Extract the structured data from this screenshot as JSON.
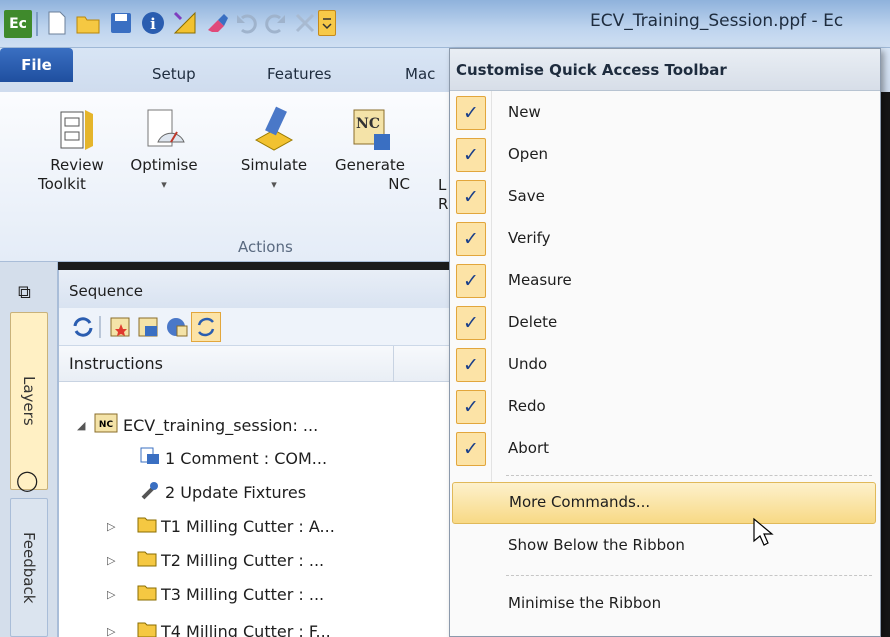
{
  "app": {
    "logo": "Ec",
    "document_title": "ECV_Training_Session.ppf - Ec"
  },
  "quick_access": {
    "icons": [
      "new-document-icon",
      "open-folder-icon",
      "save-icon",
      "info-icon",
      "measure-icon",
      "delete-icon",
      "undo-icon",
      "redo-icon",
      "abort-icon",
      "customise-dropdown-icon"
    ]
  },
  "ribbon": {
    "tabs": [
      "File",
      "Setup",
      "Features",
      "Mac"
    ],
    "buttons": [
      {
        "label_line1": "Review",
        "label_line2": "Toolkit"
      },
      {
        "label_line1": "Optimise",
        "label_line2": "▾"
      },
      {
        "label_line1": "Simulate",
        "label_line2": "▾"
      },
      {
        "label_line1": "Generate",
        "label_line2": "NC"
      },
      {
        "label_line1": "L",
        "label_line2": "R"
      }
    ],
    "group_label": "Actions"
  },
  "side_tabs": {
    "layers": "Layers",
    "feedback": "Feedback"
  },
  "sequence": {
    "title": "Sequence",
    "column_header": "Instructions",
    "rows": [
      {
        "expander": "◢",
        "text": "ECV_training_session: ..."
      },
      {
        "expander": "",
        "text": "1 Comment : COM..."
      },
      {
        "expander": "",
        "text": "2 Update Fixtures"
      },
      {
        "expander": "▷",
        "text": "T1 Milling Cutter : A..."
      },
      {
        "expander": "▷",
        "text": "T2 Milling Cutter : ..."
      },
      {
        "expander": "▷",
        "text": "T3 Milling Cutter : ..."
      },
      {
        "expander": "▷",
        "text": "T4 Milling Cutter : F..."
      }
    ]
  },
  "menu": {
    "title": "Customise Quick Access Toolbar",
    "items": [
      {
        "label": "New",
        "checked": "✓"
      },
      {
        "label": "Open",
        "checked": "✓"
      },
      {
        "label": "Save",
        "checked": "✓"
      },
      {
        "label": "Verify",
        "checked": "✓"
      },
      {
        "label": "Measure",
        "checked": "✓"
      },
      {
        "label": "Delete",
        "checked": "✓"
      },
      {
        "label": "Undo",
        "checked": "✓"
      },
      {
        "label": "Redo",
        "checked": "✓"
      },
      {
        "label": "Abort",
        "checked": "✓"
      }
    ],
    "more_commands": "More Commands...",
    "show_below": "Show Below the Ribbon",
    "minimise": "Minimise the Ribbon"
  },
  "colors": {
    "highlight": "#f8d985",
    "check_bg": "#fce3a6",
    "file_tab": "#2a5db0"
  }
}
